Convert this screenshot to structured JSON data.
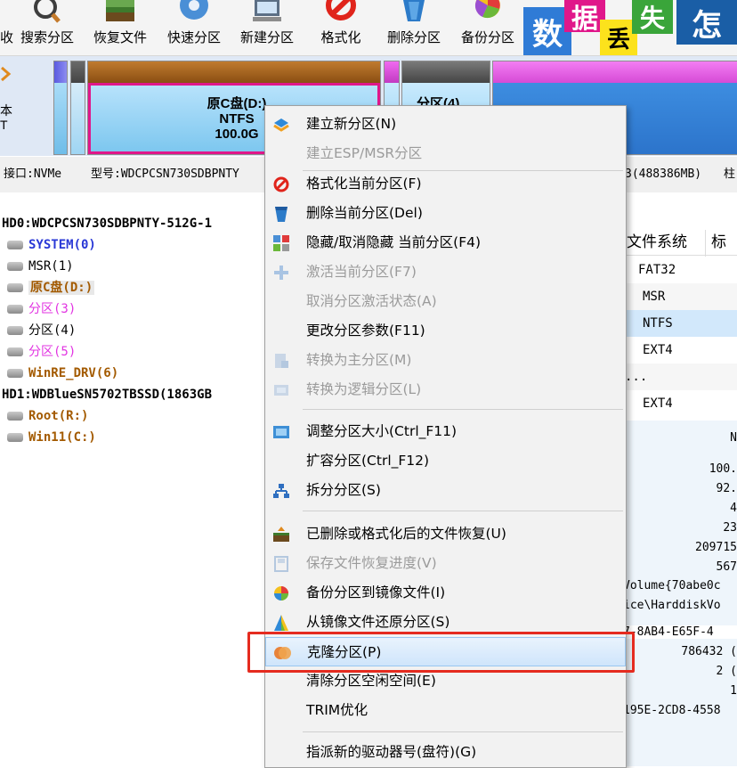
{
  "toolbar": {
    "buttons": [
      {
        "label": "收",
        "icon": "recover-icon"
      },
      {
        "label": "搜索分区",
        "icon": "search-icon"
      },
      {
        "label": "恢复文件",
        "icon": "restore-files-icon"
      },
      {
        "label": "快速分区",
        "icon": "quick-partition-icon"
      },
      {
        "label": "新建分区",
        "icon": "new-partition-icon"
      },
      {
        "label": "格式化",
        "icon": "format-icon"
      },
      {
        "label": "删除分区",
        "icon": "delete-icon"
      },
      {
        "label": "备份分区",
        "icon": "backup-icon"
      }
    ]
  },
  "logo": {
    "chars": [
      "数",
      "据",
      "丢",
      "失",
      "怎"
    ]
  },
  "diskmap": {
    "left_label_lines": [
      "本",
      "T"
    ],
    "partitions": [
      {
        "name": "原C盘(D:)",
        "fs": "NTFS",
        "size": "100.0G"
      },
      {
        "name": "分区(4)"
      }
    ]
  },
  "infoline": {
    "interface": "接口:NVMe",
    "model": "型号:WDCPCSN730SDBPNTY",
    "capacity": "3(488386MB)",
    "extra": "柱"
  },
  "tree": {
    "items": [
      {
        "label": "HD0:WDCPCSN730SDBPNTY-512G-1",
        "kind": "disk",
        "color": "#000000"
      },
      {
        "label": "SYSTEM(0)",
        "kind": "partition",
        "color": "#2a39d6"
      },
      {
        "label": "MSR(1)",
        "kind": "partition",
        "color": "#000000"
      },
      {
        "label": "原C盘(D:)",
        "kind": "partition",
        "color": "#a35a00"
      },
      {
        "label": "分区(3)",
        "kind": "partition",
        "color": "#e234e2"
      },
      {
        "label": "分区(4)",
        "kind": "partition",
        "color": "#000000"
      },
      {
        "label": "分区(5)",
        "kind": "partition",
        "color": "#e234e2"
      },
      {
        "label": "WinRE_DRV(6)",
        "kind": "partition",
        "color": "#a35a00"
      },
      {
        "label": "HD1:WDBlueSN5702TBSSD(1863GB",
        "kind": "disk",
        "color": "#000000"
      },
      {
        "label": "Root(R:)",
        "kind": "partition",
        "color": "#a35a00"
      },
      {
        "label": "Win11(C:)",
        "kind": "partition",
        "color": "#a35a00"
      }
    ]
  },
  "rpanel": {
    "headers": [
      "文件系统",
      "标识"
    ],
    "rows": [
      "FAT32",
      "MSR",
      "NTFS",
      "EXT4",
      "...",
      "EXT4"
    ],
    "details": [
      "N",
      "100.",
      "92.",
      "4",
      "23",
      "209715",
      "567",
      "Volume{70abe0c",
      "ice\\HarddiskVo",
      "7-8AB4-E65F-4",
      "786432 (",
      "2 (",
      "1",
      "195E-2CD8-4558"
    ]
  },
  "menu": {
    "items": [
      {
        "label": "建立新分区(N)",
        "icon": "new-partition-icon",
        "disabled": false
      },
      {
        "label": "建立ESP/MSR分区",
        "icon": "",
        "disabled": true
      },
      {
        "label": "格式化当前分区(F)",
        "icon": "format-icon",
        "disabled": false
      },
      {
        "label": "删除当前分区(Del)",
        "icon": "delete-icon",
        "disabled": false
      },
      {
        "label": "隐藏/取消隐藏 当前分区(F4)",
        "icon": "hide-icon",
        "disabled": false
      },
      {
        "label": "激活当前分区(F7)",
        "icon": "activate-icon",
        "disabled": true
      },
      {
        "label": "取消分区激活状态(A)",
        "icon": "",
        "disabled": true
      },
      {
        "label": "更改分区参数(F11)",
        "icon": "",
        "disabled": false
      },
      {
        "label": "转换为主分区(M)",
        "icon": "convert-primary-icon",
        "disabled": true
      },
      {
        "label": "转换为逻辑分区(L)",
        "icon": "convert-logical-icon",
        "disabled": true
      },
      {
        "label": "调整分区大小(Ctrl_F11)",
        "icon": "resize-icon",
        "disabled": false
      },
      {
        "label": "扩容分区(Ctrl_F12)",
        "icon": "",
        "disabled": false
      },
      {
        "label": "拆分分区(S)",
        "icon": "split-icon",
        "disabled": false
      },
      {
        "label": "已删除或格式化后的文件恢复(U)",
        "icon": "file-recovery-icon",
        "disabled": false
      },
      {
        "label": "保存文件恢复进度(V)",
        "icon": "save-progress-icon",
        "disabled": true
      },
      {
        "label": "备份分区到镜像文件(I)",
        "icon": "backup-image-icon",
        "disabled": false
      },
      {
        "label": "从镜像文件还原分区(S)",
        "icon": "restore-image-icon",
        "disabled": false
      },
      {
        "label": "克隆分区(P)",
        "icon": "clone-icon",
        "disabled": false,
        "highlighted": true
      },
      {
        "label": "清除分区空闲空间(E)",
        "icon": "",
        "disabled": false
      },
      {
        "label": "TRIM优化",
        "icon": "",
        "disabled": false
      },
      {
        "label": "指派新的驱动器号(盘符)(G)",
        "icon": "",
        "disabled": false
      }
    ]
  }
}
